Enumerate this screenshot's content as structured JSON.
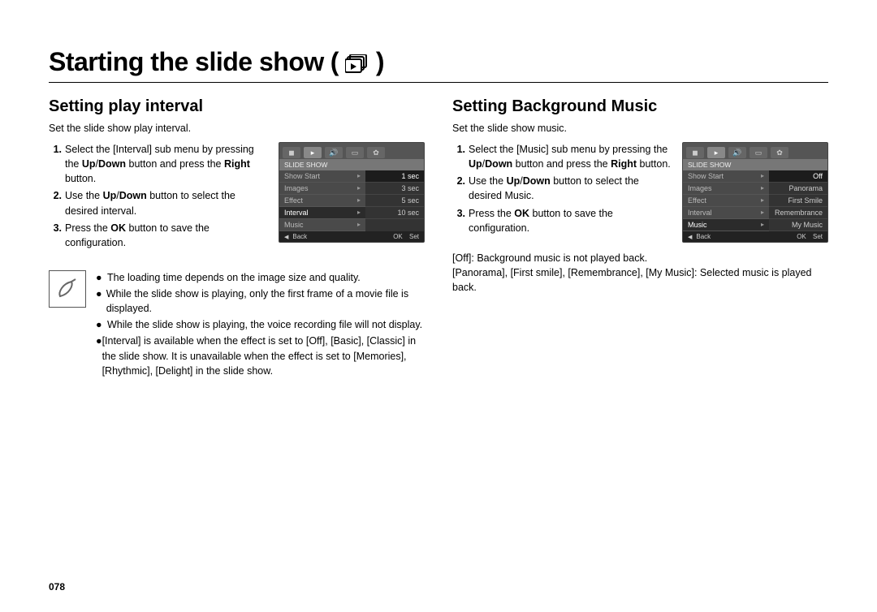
{
  "title": "Starting the slide show",
  "left": {
    "heading": "Setting play interval",
    "intro": "Set the slide show play interval.",
    "steps": [
      {
        "t": "Select the [Interval] sub menu by pressing the ",
        "b1": "Up",
        "sep": "/",
        "b2": "Down",
        "tail": " button and press the ",
        "b3": "Right",
        "end": " button."
      },
      {
        "pre": "Use the ",
        "b1": "Up",
        "sep": "/",
        "b2": "Down",
        "tail": " button to select the desired interval."
      },
      {
        "pre": "Press the ",
        "b1": "OK",
        "tail": " button to save the configuration."
      }
    ],
    "screen": {
      "header": "SLIDE SHOW",
      "leftMenu": [
        {
          "label": "Show Start"
        },
        {
          "label": "Images"
        },
        {
          "label": "Effect"
        },
        {
          "label": "Interval",
          "selected": true
        },
        {
          "label": "Music"
        }
      ],
      "rightOpts": [
        {
          "label": "1 sec",
          "selected": true
        },
        {
          "label": "3 sec"
        },
        {
          "label": "5 sec"
        },
        {
          "label": "10 sec"
        }
      ],
      "footerLeft": "Back",
      "footerRightPrefix": "OK",
      "footerRightLabel": "Set"
    },
    "notes": [
      "The loading time depends on the image size and quality.",
      "While the slide show is playing, only the first frame of a movie file is displayed.",
      "While the slide show is playing, the voice recording file will not display.",
      "[Interval] is available when the effect is set to [Off], [Basic], [Classic] in the slide show. It is unavailable when the effect is set to [Memories], [Rhythmic], [Delight] in the slide show."
    ]
  },
  "right": {
    "heading": "Setting Background Music",
    "intro": "Set the slide show music.",
    "steps": [
      {
        "t": "Select the [Music] sub menu by pressing the ",
        "b1": "Up",
        "sep": "/",
        "b2": "Down",
        "tail": " button and press the ",
        "b3": "Right",
        "end": " button."
      },
      {
        "pre": "Use the ",
        "b1": "Up",
        "sep": "/",
        "b2": "Down",
        "tail": " button to select the desired Music."
      },
      {
        "pre": "Press the ",
        "b1": "OK",
        "tail": " button to save the configuration."
      }
    ],
    "explain": "[Off]: Background music is not played back.\n[Panorama], [First smile], [Remembrance], [My Music]: Selected music is played back.",
    "screen": {
      "header": "SLIDE SHOW",
      "leftMenu": [
        {
          "label": "Show Start"
        },
        {
          "label": "Images"
        },
        {
          "label": "Effect"
        },
        {
          "label": "Interval"
        },
        {
          "label": "Music",
          "selected": true
        }
      ],
      "rightOpts": [
        {
          "label": "Off",
          "selected": true
        },
        {
          "label": "Panorama"
        },
        {
          "label": "First Smile"
        },
        {
          "label": "Remembrance"
        },
        {
          "label": "My Music"
        }
      ],
      "footerLeft": "Back",
      "footerRightPrefix": "OK",
      "footerRightLabel": "Set"
    }
  },
  "pageNum": "078"
}
